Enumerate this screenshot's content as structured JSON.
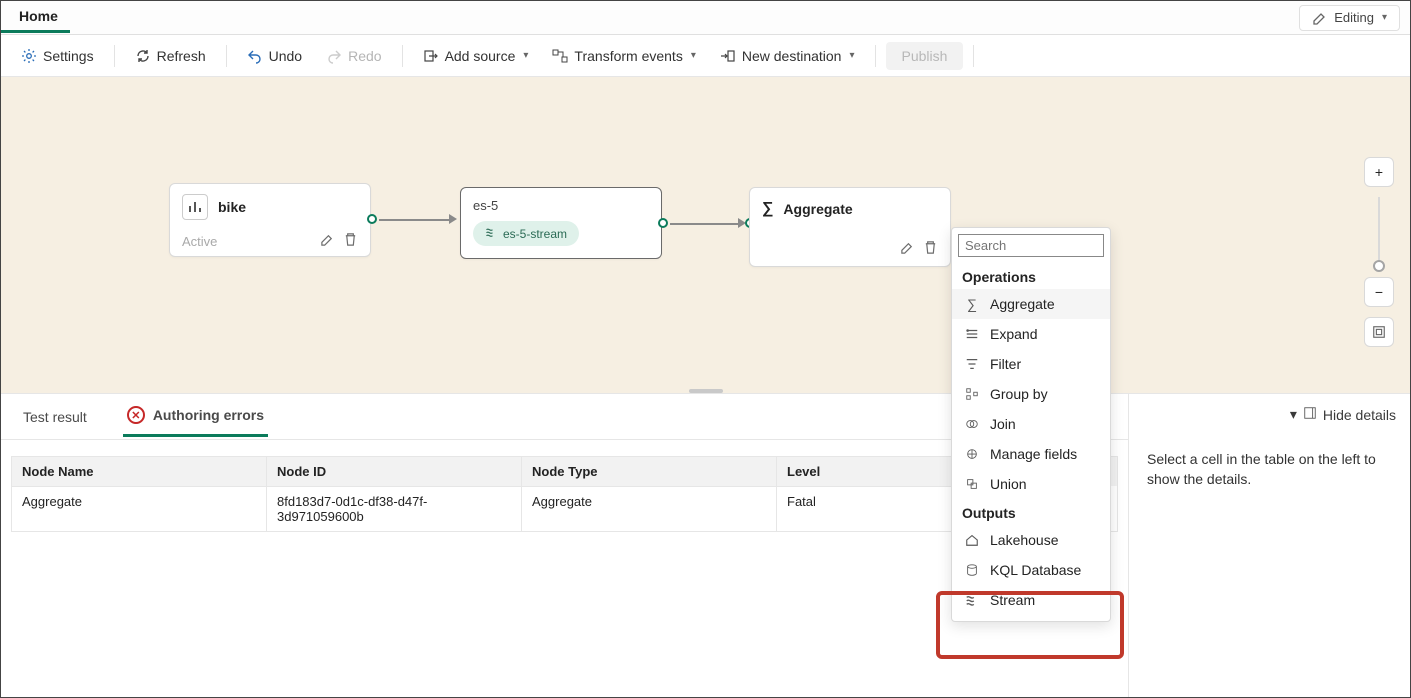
{
  "titlebar": {
    "home": "Home",
    "editing": "Editing"
  },
  "toolbar": {
    "settings": "Settings",
    "refresh": "Refresh",
    "undo": "Undo",
    "redo": "Redo",
    "add_source": "Add source",
    "transform_events": "Transform events",
    "new_destination": "New destination",
    "publish": "Publish"
  },
  "nodes": {
    "bike": {
      "title": "bike",
      "status": "Active"
    },
    "es5": {
      "title": "es-5",
      "pill": "es-5-stream"
    },
    "agg": {
      "title": "Aggregate"
    }
  },
  "menu": {
    "search_placeholder": "Search",
    "header_ops": "Operations",
    "ops": {
      "aggregate": "Aggregate",
      "expand": "Expand",
      "filter": "Filter",
      "groupby": "Group by",
      "join": "Join",
      "manage": "Manage fields",
      "union": "Union"
    },
    "header_out": "Outputs",
    "outs": {
      "lakehouse": "Lakehouse",
      "kql": "KQL Database",
      "stream": "Stream"
    }
  },
  "bottom": {
    "tab_test": "Test result",
    "tab_errors": "Authoring errors",
    "hide": "Hide details",
    "details_text": "Select a cell in the table on the left to show the details.",
    "columns": {
      "name": "Node Name",
      "id": "Node ID",
      "type": "Node Type",
      "level": "Level"
    },
    "row": {
      "name": "Aggregate",
      "id": "8fd183d7-0d1c-df38-d47f-3d971059600b",
      "type": "Aggregate",
      "level": "Fatal"
    }
  }
}
